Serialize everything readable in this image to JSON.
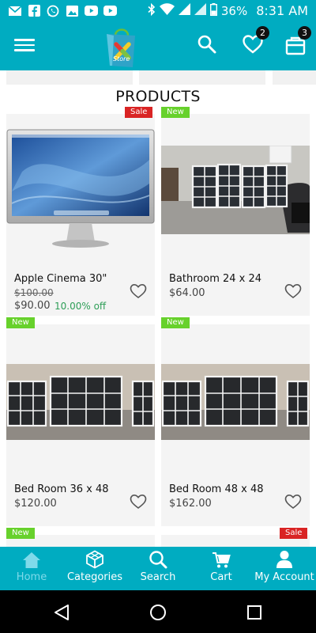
{
  "status_bar": {
    "battery": "36%",
    "time": "8:31 AM"
  },
  "app_bar": {
    "logo_text": "Store",
    "wishlist_count": "2",
    "cart_count": "3"
  },
  "section": {
    "title": "PRODUCTS"
  },
  "products": [
    {
      "name": "Apple Cinema 30\"",
      "old_price": "$100.00",
      "price": "$90.00",
      "discount": "10.00% off",
      "tag": "Sale"
    },
    {
      "name": "Bathroom 24 x 24",
      "price": "$64.00",
      "tag": "New"
    },
    {
      "name": "Bed Room 36 x 48",
      "price": "$120.00",
      "tag": "New"
    },
    {
      "name": "Bed Room 48 x 48",
      "price": "$162.00",
      "tag": "New"
    }
  ],
  "next_row_tags": [
    "New",
    "Sale"
  ],
  "bottom_nav": [
    {
      "label": "Home",
      "icon": "home-icon",
      "active": true
    },
    {
      "label": "Categories",
      "icon": "categories-icon"
    },
    {
      "label": "Search",
      "icon": "search-icon"
    },
    {
      "label": "Cart",
      "icon": "cart-icon"
    },
    {
      "label": "My Account",
      "icon": "account-icon"
    }
  ],
  "colors": {
    "primary": "#00acc1",
    "sale_tag": "#d92424",
    "new_tag": "#67d12c",
    "discount_text": "#2e9e57",
    "nav_active": "#7fdaea"
  }
}
